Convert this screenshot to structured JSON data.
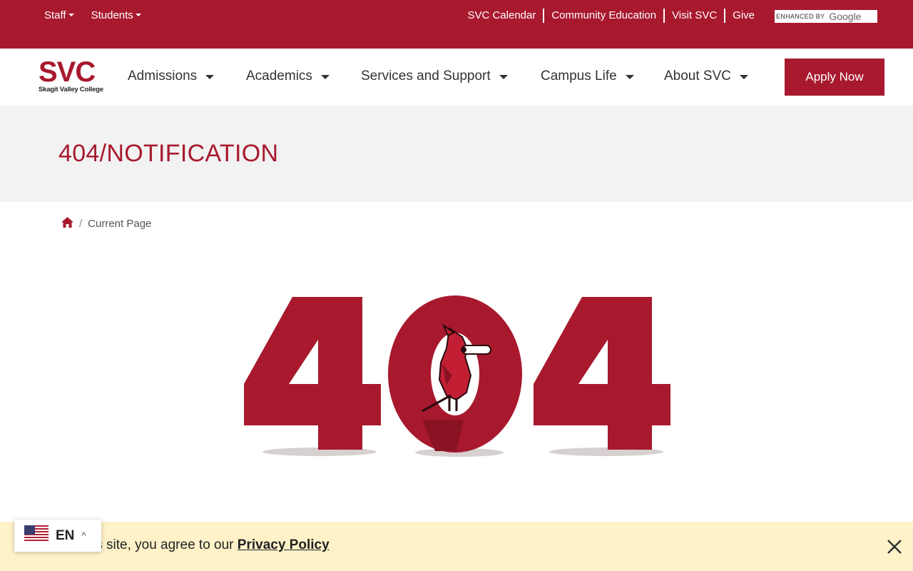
{
  "topbar": {
    "menus": [
      {
        "label": "Staff"
      },
      {
        "label": "Students"
      }
    ],
    "links": [
      {
        "label": "SVC Calendar"
      },
      {
        "label": "Community Education"
      },
      {
        "label": "Visit SVC"
      },
      {
        "label": "Give"
      }
    ],
    "search": {
      "enhanced": "ENHANCED BY",
      "brand": "Google"
    }
  },
  "logo": {
    "text": "SVC",
    "subtitle": "Skagit Valley College"
  },
  "nav": {
    "items": [
      {
        "label": "Admissions"
      },
      {
        "label": "Academics"
      },
      {
        "label": "Services and Support"
      },
      {
        "label": "Campus Life"
      },
      {
        "label": "About SVC"
      }
    ],
    "apply_label": "Apply Now"
  },
  "hero": {
    "title": "404/NOTIFICATION"
  },
  "breadcrumb": {
    "separator": "/",
    "current": "Current Page"
  },
  "error": {
    "code": "404"
  },
  "cookie": {
    "text": "By using this site, you agree to our",
    "link": "Privacy Policy"
  },
  "language": {
    "code": "EN"
  },
  "colors": {
    "brand": "#a8192e",
    "hero_bg": "#f2f2f2",
    "cookie_bg": "#fff2c9"
  }
}
